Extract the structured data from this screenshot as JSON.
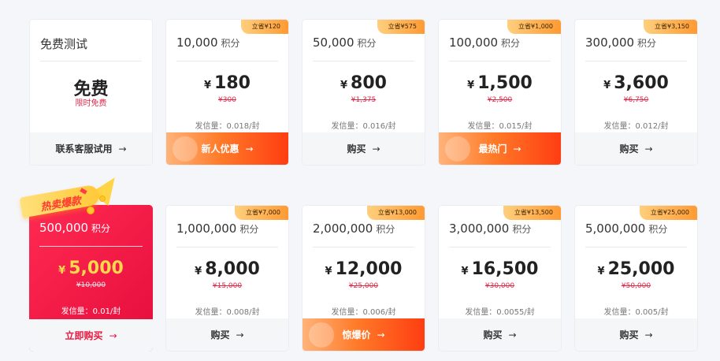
{
  "colors": {
    "accent": "#e8183f",
    "orange": "#ff5a1f",
    "badge": "#ffb04a"
  },
  "free_card": {
    "title": "免费测试",
    "price": "免费",
    "sub": "限时免费",
    "footer": "联系客服试用",
    "arrow": "→"
  },
  "row1": [
    {
      "badge": "立省¥120",
      "credits": "10,000",
      "unit": "积分",
      "yen": "¥",
      "price": "180",
      "orig": "¥300",
      "rate": "发信量：0.018/封",
      "footer": "新人优惠",
      "arrow": "→",
      "footer_icon": "new-user-icon"
    },
    {
      "badge": "立省¥575",
      "credits": "50,000",
      "unit": "积分",
      "yen": "¥",
      "price": "800",
      "orig": "¥1,375",
      "rate": "发信量：0.016/封",
      "footer": "购买",
      "arrow": "→"
    },
    {
      "badge": "立省¥1,000",
      "credits": "100,000",
      "unit": "积分",
      "yen": "¥",
      "price": "1,500",
      "orig": "¥2,500",
      "rate": "发信量：0.015/封",
      "footer": "最热门",
      "arrow": "→",
      "footer_icon": "flame-icon"
    },
    {
      "badge": "立省¥3,150",
      "credits": "300,000",
      "unit": "积分",
      "yen": "¥",
      "price": "3,600",
      "orig": "¥6,750",
      "rate": "发信量：0.012/封",
      "footer": "购买",
      "arrow": "→"
    }
  ],
  "row2": [
    {
      "tag": "热卖爆款",
      "credits": "500,000",
      "unit": "积分",
      "yen": "¥",
      "price": "5,000",
      "orig": "¥10,000",
      "rate": "发信量：0.01/封",
      "footer": "立即购买",
      "arrow": "→"
    },
    {
      "badge": "立省¥7,000",
      "credits": "1,000,000",
      "unit": "积分",
      "yen": "¥",
      "price": "8,000",
      "orig": "¥15,000",
      "rate": "发信量：0.008/封",
      "footer": "购买",
      "arrow": "→"
    },
    {
      "badge": "立省¥13,000",
      "credits": "2,000,000",
      "unit": "积分",
      "yen": "¥",
      "price": "12,000",
      "orig": "¥25,000",
      "rate": "发信量：0.006/封",
      "footer": "惊爆价",
      "arrow": "→",
      "footer_icon": "flame-icon"
    },
    {
      "badge": "立省¥13,500",
      "credits": "3,000,000",
      "unit": "积分",
      "yen": "¥",
      "price": "16,500",
      "orig": "¥30,000",
      "rate": "发信量：0.0055/封",
      "footer": "购买",
      "arrow": "→"
    },
    {
      "badge": "立省¥25,000",
      "credits": "5,000,000",
      "unit": "积分",
      "yen": "¥",
      "price": "25,000",
      "orig": "¥50,000",
      "rate": "发信量：0.005/封",
      "footer": "购买",
      "arrow": "→"
    }
  ]
}
